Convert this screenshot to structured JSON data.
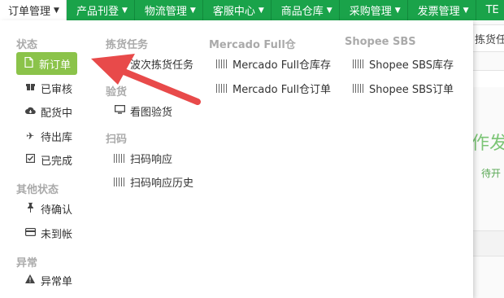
{
  "topnav": {
    "items": [
      {
        "label": "订单管理",
        "active": true
      },
      {
        "label": "产品刊登"
      },
      {
        "label": "物流管理"
      },
      {
        "label": "客服中心"
      },
      {
        "label": "商品仓库"
      },
      {
        "label": "采购管理"
      },
      {
        "label": "发票管理"
      },
      {
        "label": "TE"
      }
    ]
  },
  "background": {
    "tab_label": "拣货任",
    "heading": "作发货",
    "subtext": "待开"
  },
  "menu": {
    "status": {
      "header": "状态",
      "items": [
        {
          "label": "新订单",
          "icon": "file-icon"
        },
        {
          "label": "已审核",
          "icon": "gift-icon"
        },
        {
          "label": "配货中",
          "icon": "cloud-download-icon"
        },
        {
          "label": "待出库",
          "icon": "plane-icon"
        },
        {
          "label": "已完成",
          "icon": "check-square-icon"
        }
      ]
    },
    "other_status": {
      "header": "其他状态",
      "items": [
        {
          "label": "待确认",
          "icon": "pin-icon"
        },
        {
          "label": "未到帐",
          "icon": "credit-card-icon"
        }
      ]
    },
    "exception": {
      "header": "异常",
      "items": [
        {
          "label": "异常单",
          "icon": "warning-icon"
        }
      ]
    },
    "picking": {
      "header": "拣货任务",
      "items": [
        {
          "label": "波次拣货任务",
          "icon": "list-icon"
        }
      ]
    },
    "inspection": {
      "header": "验货",
      "items": [
        {
          "label": "看图验货",
          "icon": "monitor-icon"
        }
      ]
    },
    "scan": {
      "header": "扫码",
      "items": [
        {
          "label": "扫码响应",
          "icon": "barcode-icon"
        },
        {
          "label": "扫码响应历史",
          "icon": "barcode-icon"
        }
      ]
    },
    "mercado": {
      "header": "Mercado Full仓",
      "items": [
        {
          "label": "Mercado Full仓库存",
          "icon": "barcode-icon"
        },
        {
          "label": "Mercado Full仓订单",
          "icon": "barcode-icon"
        }
      ]
    },
    "shopee": {
      "header": "Shopee SBS",
      "items": [
        {
          "label": "Shopee SBS库存",
          "icon": "barcode-icon"
        },
        {
          "label": "Shopee SBS订单",
          "icon": "barcode-icon"
        }
      ]
    }
  },
  "colors": {
    "nav_green": "#1aa34a",
    "selected_green": "#8bc34a",
    "arrow_red": "#e84a4a"
  }
}
